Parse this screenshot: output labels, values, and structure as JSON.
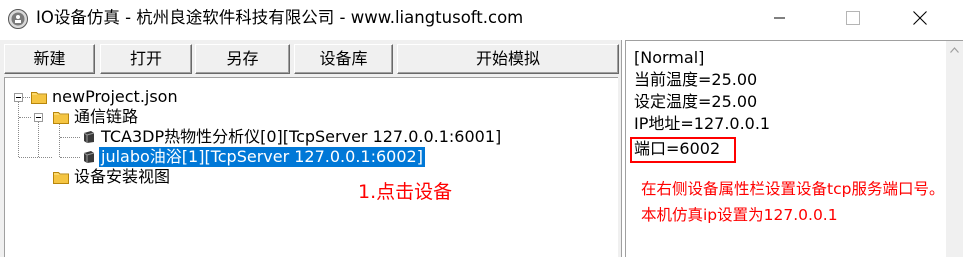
{
  "window": {
    "title": "IO设备仿真 - 杭州良途软件科技有限公司 - www.liangtusoft.com",
    "icon": "app-logo-icon",
    "controls": {
      "minimize": "minimize-icon",
      "maximize": "maximize-icon",
      "close": "close-icon"
    }
  },
  "toolbar": {
    "new_label": "新建",
    "open_label": "打开",
    "saveas_label": "另存",
    "device_library_label": "设备库",
    "start_sim_label": "开始模拟"
  },
  "tree": {
    "root": {
      "label": "newProject.json",
      "icon": "folder-icon"
    },
    "comm_link": {
      "label": "通信链路",
      "icon": "folder-icon"
    },
    "devices": [
      {
        "label": "TCA3DP热物性分析仪[0][TcpServer 127.0.0.1:6001]",
        "icon": "device-icon",
        "selected": false
      },
      {
        "label": "julabo油浴[1][TcpServer 127.0.0.1:6002]",
        "icon": "device-icon",
        "selected": true
      }
    ],
    "install_view": {
      "label": "设备安装视图",
      "icon": "folder-icon"
    }
  },
  "annotations": {
    "left_note": "1.点击设备",
    "right_note": "在右侧设备属性栏设置设备tcp服务端口号。本机仿真ip设置为127.0.0.1",
    "color": "#ff0000"
  },
  "properties": {
    "lines": [
      "[Normal]",
      "当前温度=25.00",
      "设定温度=25.00",
      "IP地址=127.0.0.1",
      "端口=6002"
    ]
  },
  "colors": {
    "selection": "#0078d7",
    "highlight_box": "#ff0000",
    "panel_bg": "#f0f0f0"
  }
}
